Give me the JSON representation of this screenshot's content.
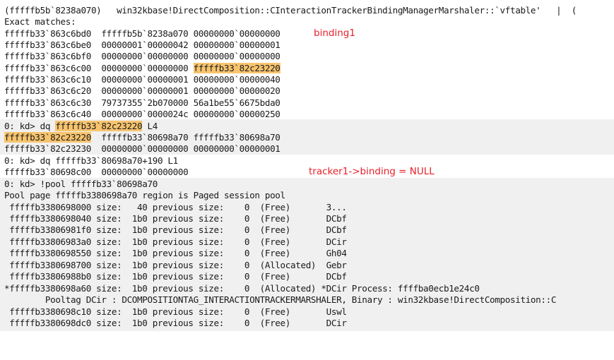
{
  "header": "(fffffb5b`8238a070)   win32kbase!DirectComposition::CInteractionTrackerBindingManagerMarshaler::`vftable'   |  (",
  "exact_matches": "Exact matches:",
  "dump1": {
    "rows": [
      "fffffb33`863c6bd0  fffffb5b`8238a070 00000000`00000000",
      "fffffb33`863c6be0  00000001`00000042 00000000`00000001",
      "fffffb33`863c6bf0  00000000`00000000 00000000`00000000",
      "fffffb33`863c6c00  00000000`00000000 ",
      "fffffb33`863c6c10  00000000`00000001 00000000`00000040",
      "fffffb33`863c6c20  00000000`00000001 00000000`00000020",
      "fffffb33`863c6c30  79737355`2b070000 56a1be55`6675bda0",
      "fffffb33`863c6c40  00000000`0000024c 00000000`00000250"
    ],
    "highlight": "fffffb33`82c23220"
  },
  "annotations": {
    "binding1": "binding1",
    "tracker_null": "tracker1->binding = NULL"
  },
  "cmd1": {
    "prompt": "0: kd> dq ",
    "arg_highlight": "fffffb33`82c23220",
    "arg_rest": " L4"
  },
  "dump2": {
    "row1_addr": "fffffb33`82c23220",
    "row1_rest": "  fffffb33`80698a70 fffffb33`80698a70",
    "row2": "fffffb33`82c23230  00000000`00000000 00000000`00000001"
  },
  "cmd2": "0: kd> dq fffffb33`80698a70+190 L1",
  "dump3": "fffffb33`80698c00  00000000`00000000",
  "cmd3": "0: kd> !pool fffffb33`80698a70",
  "pool_header": "Pool page fffffb3380698a70 region is Paged session pool",
  "pool_rows": [
    " fffffb3380698000 size:   40 previous size:    0  (Free)       3...",
    " fffffb3380698040 size:  1b0 previous size:    0  (Free)       DCbf",
    " fffffb33806981f0 size:  1b0 previous size:    0  (Free)       DCbf",
    " fffffb33806983a0 size:  1b0 previous size:    0  (Free)       DCir",
    " fffffb3380698550 size:  1b0 previous size:    0  (Free)       Gh04",
    " fffffb3380698700 size:  1b0 previous size:    0  (Allocated)  Gebr",
    " fffffb33806988b0 size:  1b0 previous size:    0  (Free)       DCbf",
    "*fffffb3380698a60 size:  1b0 previous size:    0  (Allocated) *DCir Process: ffffba0ecb1e24c0",
    "        Pooltag DCir : DCOMPOSITIONTAG_INTERACTIONTRACKERMARSHALER, Binary : win32kbase!DirectComposition::C",
    " fffffb3380698c10 size:  1b0 previous size:    0  (Free)       Uswl",
    " fffffb3380698dc0 size:  1b0 previous size:    0  (Free)       DCir"
  ]
}
